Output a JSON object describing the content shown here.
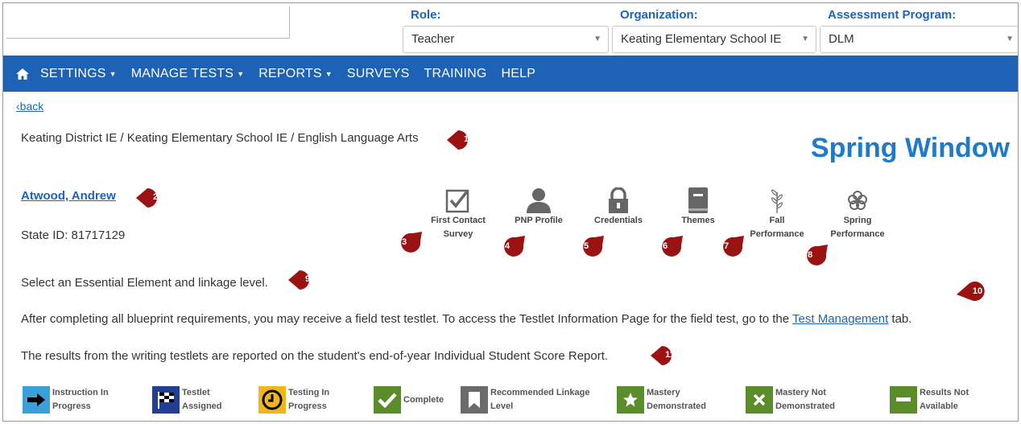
{
  "header": {
    "role": {
      "label": "Role:",
      "value": "Teacher"
    },
    "organization": {
      "label": "Organization:",
      "value": "Keating Elementary School IE"
    },
    "program": {
      "label": "Assessment Program:",
      "value": "DLM"
    }
  },
  "nav": {
    "settings": "SETTINGS",
    "manage_tests": "MANAGE TESTS",
    "reports": "REPORTS",
    "surveys": "SURVEYS",
    "training": "TRAINING",
    "help": "HELP"
  },
  "page": {
    "back": "‹back",
    "breadcrumb": "Keating District IE / Keating Elementary School IE / English Language Arts",
    "window_title": "Spring Window",
    "student_name": "Atwood, Andrew",
    "state_id": "State ID: 81717129",
    "instruction": "Select an Essential Element and linkage level.",
    "field_test_before": "After completing all blueprint requirements, you may receive a field test testlet. To access the Testlet Information Page for the field test, go to the ",
    "field_test_link": "Test Management",
    "field_test_after": " tab.",
    "writing_note": "The results from the writing testlets are reported on the student's end-of-year Individual Student Score Report."
  },
  "toolbar": {
    "first_contact_1": "First Contact",
    "first_contact_2": "Survey",
    "pnp": "PNP Profile",
    "credentials": "Credentials",
    "themes": "Themes",
    "fall_1": "Fall",
    "fall_2": "Performance",
    "spring_1": "Spring",
    "spring_2": "Performance"
  },
  "markers": [
    "1",
    "2",
    "3",
    "4",
    "5",
    "6",
    "7",
    "8",
    "9",
    "10",
    "11"
  ],
  "legend": {
    "instruction_1": "Instruction In",
    "instruction_2": "Progress",
    "assigned_1": "Testlet",
    "assigned_2": "Assigned",
    "testing_1": "Testing In",
    "testing_2": "Progress",
    "complete": "Complete",
    "recommended_1": "Recommended Linkage",
    "recommended_2": "Level",
    "mastery_1": "Mastery",
    "mastery_2": "Demonstrated",
    "not_mastery_1": "Mastery Not",
    "not_mastery_2": "Demonstrated",
    "results_1": "Results Not",
    "results_2": "Available"
  },
  "colors": {
    "nav_bg": "#1e62b6",
    "link": "#1e63b8",
    "title": "#1f7ac8",
    "marker": "#9b1212",
    "instruction_icon": "#3b9fd8",
    "assigned_icon": "#233f94",
    "testing_icon": "#f2b51a",
    "green_icon": "#5b8c2a",
    "gray_icon": "#6b6b6b"
  }
}
